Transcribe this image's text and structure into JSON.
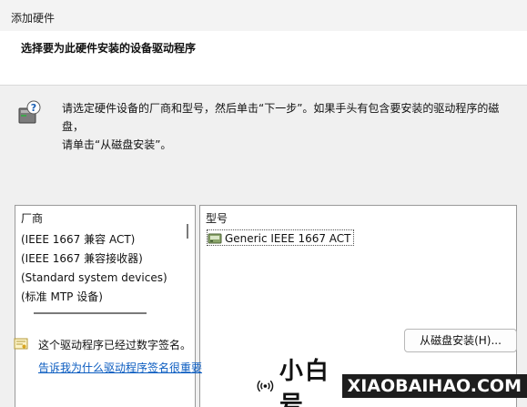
{
  "window": {
    "title": "添加硬件"
  },
  "header": {
    "title": "选择要为此硬件安装的设备驱动程序"
  },
  "instruction": {
    "line1": "请选定硬件设备的厂商和型号，然后单击“下一步”。如果手头有包含要安装的驱动程序的磁盘，",
    "line2": "请单击“从磁盘安装”。"
  },
  "manufacturer_list": {
    "header": "厂商",
    "items": [
      "(IEEE 1667 兼容 ACT)",
      "(IEEE 1667 兼容接收器)",
      "(Standard system devices)",
      "(标准 MTP 设备)"
    ]
  },
  "model_list": {
    "header": "型号",
    "items": [
      "Generic IEEE 1667 ACT"
    ]
  },
  "signature": {
    "text": "这个驱动程序已经过数字签名。",
    "link": "告诉我为什么驱动程序签名很重要"
  },
  "buttons": {
    "have_disk": "从磁盘安装(H)..."
  },
  "watermark": {
    "cn": "小白号",
    "en": "XIAOBAIHAO.COM"
  },
  "icons": {
    "hardware": "hardware-help-icon",
    "model": "device-icon",
    "signature": "certificate-icon",
    "watermark": "broadcast-icon"
  }
}
